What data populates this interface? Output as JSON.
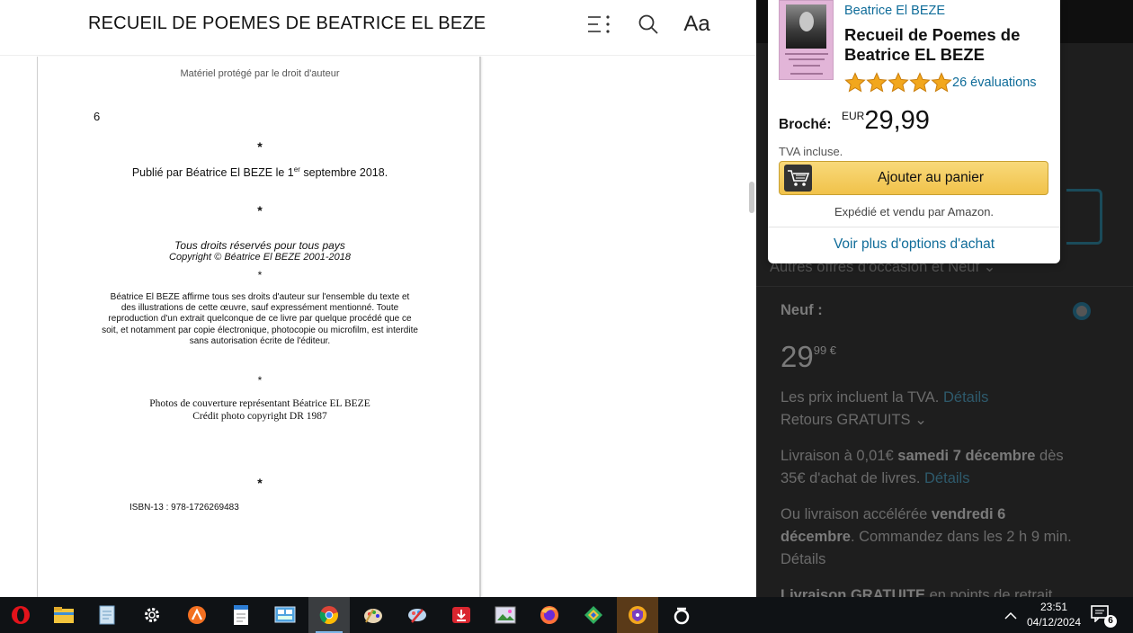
{
  "reader": {
    "title": "RECUEIL DE POEMES DE BEATRICE EL BEZE",
    "icons": [
      "table-of-contents-icon",
      "search-icon",
      "font-settings-icon"
    ],
    "font_button_label": "Aa",
    "page": {
      "protected_notice": "Matériel protégé par le droit d'auteur",
      "page_number": "6",
      "star": "*",
      "published_pre": "Publié par Béatrice El BEZE le 1",
      "published_sup": "er",
      "published_post": " septembre 2018.",
      "rights": "Tous droits réservés pour tous pays",
      "copyright": "Copyright © Béatrice El BEZE 2001-2018",
      "paragraph_lines": [
        "Béatrice El BEZE affirme tous ses droits d'auteur sur l'ensemble du texte et",
        "des illustrations de cette œuvre, sauf expressément mentionné. Toute",
        "reproduction d'un extrait quelconque de ce livre par quelque procédé que ce",
        "soit, et notamment par copie électronique, photocopie ou microfilm, est interdite",
        "sans autorisation écrite de l'éditeur."
      ],
      "photos_line1": "Photos de couverture représentant Béatrice EL BEZE",
      "photos_line2": "Crédit photo copyright DR 1987",
      "isbn": "ISBN-13 : 978-1726269483"
    }
  },
  "popup": {
    "author": "Beatrice El BEZE",
    "title": "Recueil de Poemes de Beatrice EL BEZE",
    "rating_stars": 5,
    "reviews": "26 évaluations",
    "format_label": "Broché:",
    "currency": "EUR",
    "price": "29,99",
    "tax_note": "TVA incluse.",
    "add_to_cart": "Ajouter au panier",
    "shipped_by": "Expédié et vendu par Amazon.",
    "more_options": "Voir plus d'options d'achat",
    "colors": {
      "link": "#0f6c99",
      "button": "#f1c24a",
      "star": "#f2a71d"
    }
  },
  "background_panel": {
    "other_offers": "Autres offres d'occasion et Neuf",
    "neuf": "Neuf :",
    "price_main": "29",
    "price_cents": "99 €",
    "taxes": "Les prix incluent la TVA.",
    "details": "Détails",
    "returns": "Retours GRATUITS",
    "delivery_pre": "Livraison à 0,01€ ",
    "delivery_date": "samedi 7 décembre",
    "delivery_post": " dès",
    "delivery_line2": "35€ d'achat de livres.",
    "express_pre": "Ou livraison accélérée ",
    "express_date1": "vendredi 6",
    "express_date2": "décembre",
    "express_post": ". Commandez dans les 2 h 9 min.",
    "free_delivery": "Livraison GRATUITE",
    "free_delivery_post": " en points de retrait"
  },
  "taskbar": {
    "apps": [
      "opera-icon",
      "file-explorer-icon",
      "notepad-icon",
      "settings-icon",
      "avast-icon",
      "document-icon",
      "control-panel-icon",
      "chrome-icon",
      "paint-icon",
      "paint-brush-icon",
      "download-icon",
      "photo-viewer-icon",
      "firefox-icon",
      "kaspersky-icon",
      "vpn-icon",
      "app-icon"
    ],
    "time": "23:51",
    "date": "04/12/2024",
    "notifications": "6"
  }
}
